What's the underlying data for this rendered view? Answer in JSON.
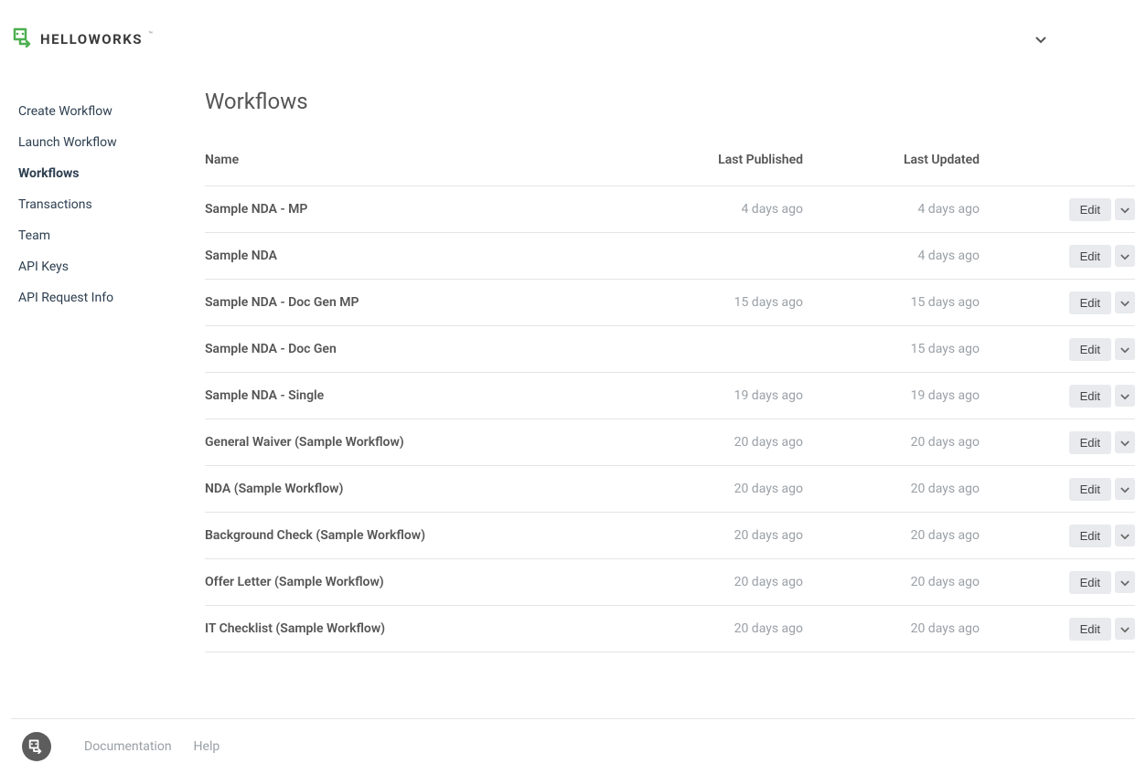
{
  "brand": "HELLOWORKS",
  "sidebar": {
    "items": [
      {
        "label": "Create Workflow",
        "active": false
      },
      {
        "label": "Launch Workflow",
        "active": false
      },
      {
        "label": "Workflows",
        "active": true
      },
      {
        "label": "Transactions",
        "active": false
      },
      {
        "label": "Team",
        "active": false
      },
      {
        "label": "API Keys",
        "active": false
      },
      {
        "label": "API Request Info",
        "active": false
      }
    ]
  },
  "page": {
    "title": "Workflows"
  },
  "table": {
    "headers": {
      "name": "Name",
      "published": "Last Published",
      "updated": "Last Updated"
    },
    "edit_label": "Edit",
    "rows": [
      {
        "name": "Sample NDA - MP",
        "published": "4 days ago",
        "updated": "4 days ago"
      },
      {
        "name": "Sample NDA",
        "published": "",
        "updated": "4 days ago"
      },
      {
        "name": "Sample NDA - Doc Gen MP",
        "published": "15 days ago",
        "updated": "15 days ago"
      },
      {
        "name": "Sample NDA - Doc Gen",
        "published": "",
        "updated": "15 days ago"
      },
      {
        "name": "Sample NDA - Single",
        "published": "19 days ago",
        "updated": "19 days ago"
      },
      {
        "name": "General Waiver (Sample Workflow)",
        "published": "20 days ago",
        "updated": "20 days ago"
      },
      {
        "name": "NDA (Sample Workflow)",
        "published": "20 days ago",
        "updated": "20 days ago"
      },
      {
        "name": "Background Check (Sample Workflow)",
        "published": "20 days ago",
        "updated": "20 days ago"
      },
      {
        "name": "Offer Letter (Sample Workflow)",
        "published": "20 days ago",
        "updated": "20 days ago"
      },
      {
        "name": "IT Checklist (Sample Workflow)",
        "published": "20 days ago",
        "updated": "20 days ago"
      }
    ]
  },
  "footer": {
    "documentation": "Documentation",
    "help": "Help"
  }
}
